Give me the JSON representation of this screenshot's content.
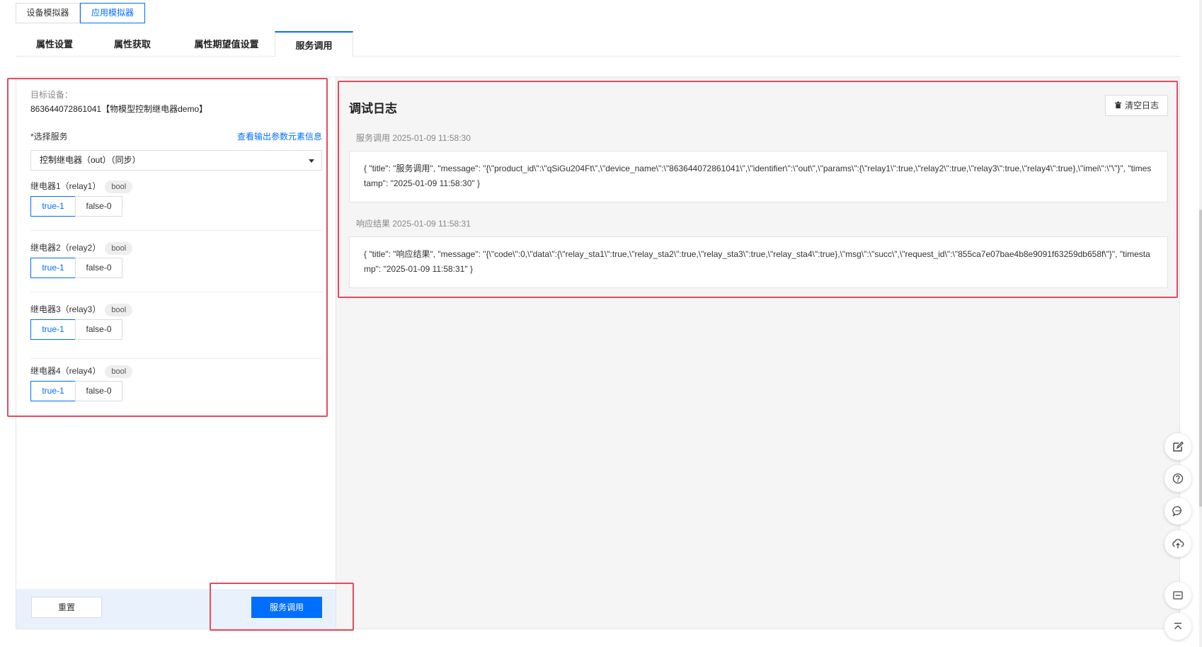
{
  "simulator_tabs": [
    {
      "label": "设备模拟器",
      "active": false
    },
    {
      "label": "应用模拟器",
      "active": true
    }
  ],
  "function_tabs": [
    {
      "label": "属性设置",
      "active": false
    },
    {
      "label": "属性获取",
      "active": false
    },
    {
      "label": "属性期望值设置",
      "active": false
    },
    {
      "label": "服务调用",
      "active": true
    }
  ],
  "left": {
    "target_label": "目标设备：",
    "target_value": "863644072861041【物模型控制继电器demo】",
    "service_label": "*选择服务",
    "output_link": "查看输出参数元素信息",
    "service_selected": "控制继电器（out）（同步）",
    "relays": [
      {
        "title": "继电器1（relay1）",
        "type": "bool",
        "true_label": "true-1",
        "false_label": "false-0",
        "selected": "true"
      },
      {
        "title": "继电器2（relay2）",
        "type": "bool",
        "true_label": "true-1",
        "false_label": "false-0",
        "selected": "true"
      },
      {
        "title": "继电器3（relay3）",
        "type": "bool",
        "true_label": "true-1",
        "false_label": "false-0",
        "selected": "true"
      },
      {
        "title": "继电器4（relay4）",
        "type": "bool",
        "true_label": "true-1",
        "false_label": "false-0",
        "selected": "true"
      }
    ],
    "reset_label": "重置",
    "invoke_label": "服务调用"
  },
  "log": {
    "title": "调试日志",
    "clear_label": "清空日志",
    "entries": [
      {
        "meta": "服务调用 2025-01-09 11:58:30",
        "body": "{ \"title\": \"服务调用\", \"message\": \"{\\\"product_id\\\":\\\"qSiGu204Ft\\\",\\\"device_name\\\":\\\"863644072861041\\\",\\\"identifier\\\":\\\"out\\\",\\\"params\\\":{\\\"relay1\\\":true,\\\"relay2\\\":true,\\\"relay3\\\":true,\\\"relay4\\\":true},\\\"imei\\\":\\\"\\\"}\", \"timestamp\": \"2025-01-09 11:58:30\" }"
      },
      {
        "meta": "响应结果 2025-01-09 11:58:31",
        "body": "{ \"title\": \"响应结果\", \"message\": \"{\\\"code\\\":0,\\\"data\\\":{\\\"relay_sta1\\\":true,\\\"relay_sta2\\\":true,\\\"relay_sta3\\\":true,\\\"relay_sta4\\\":true},\\\"msg\\\":\\\"succ\\\",\\\"request_id\\\":\\\"855ca7e07bae4b8e9091f63259db658f\\\"}\", \"timestamp\": \"2025-01-09 11:58:31\" }"
      }
    ]
  },
  "float_tools": [
    {
      "icon": "edit-icon"
    },
    {
      "icon": "help-icon"
    },
    {
      "icon": "chat-icon"
    },
    {
      "icon": "cloud-upload-icon"
    },
    {
      "icon": "window-icon"
    },
    {
      "icon": "back-to-top-icon"
    }
  ],
  "colors": {
    "accent": "#006eff",
    "annotation": "#e54a5e"
  }
}
